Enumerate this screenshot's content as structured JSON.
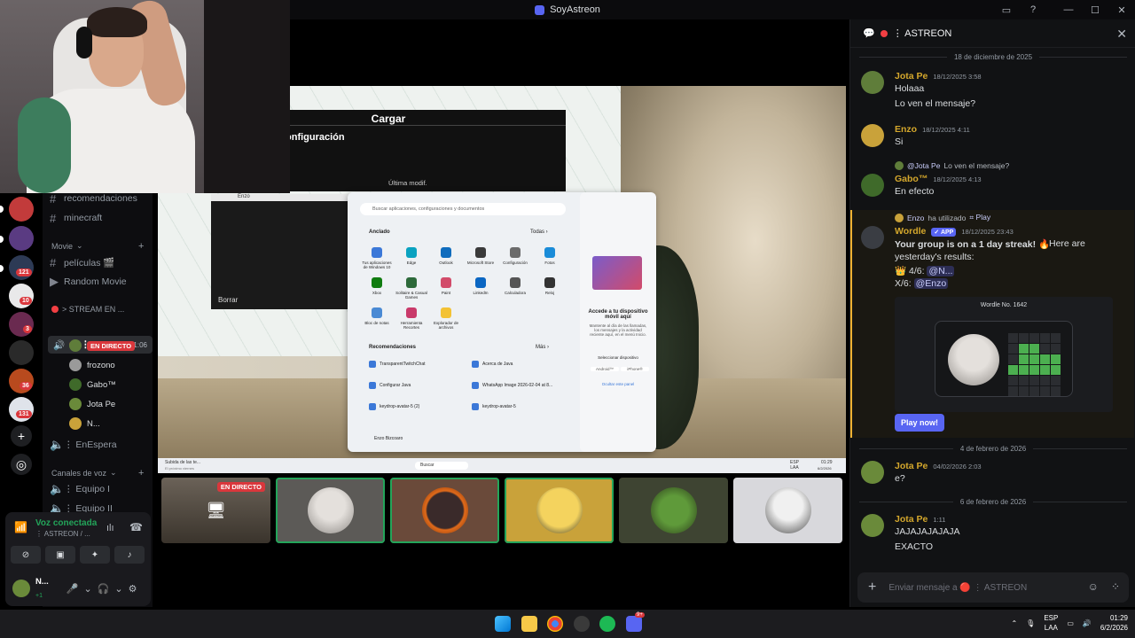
{
  "window": {
    "title": "SoyAstreon"
  },
  "rail_badges": [
    "121",
    "10",
    "3",
    "36",
    "131"
  ],
  "channels": {
    "text": [
      {
        "name": "recomendaciones"
      },
      {
        "name": "minecraft"
      }
    ],
    "movie_category": "Movie",
    "movie_channels": [
      {
        "name": "películas 🎬"
      },
      {
        "name": "Random Movie"
      }
    ],
    "stream_category": "> STREAM EN ...",
    "active_voice": {
      "name": "⋮ AS...",
      "time": "21:06"
    },
    "voice_users": [
      {
        "name": "EN DIRECTO",
        "is_live_badge": true
      },
      {
        "name": "frozono"
      },
      {
        "name": "Gabo™"
      },
      {
        "name": "Jota Pe"
      },
      {
        "name": "N..."
      }
    ],
    "waiting": "⋮ EnEspera",
    "voice_category": "Canales de voz",
    "voice_channels": [
      {
        "name": "⋮ Equipo I"
      },
      {
        "name": "⋮ Equipo II"
      }
    ]
  },
  "voice_panel": {
    "status": "Voz conectada",
    "sub": "⋮ ASTREON / ...",
    "user": "N...",
    "user_sub": "+1"
  },
  "stream": {
    "cargar_title": "Cargar",
    "cargar_item": "onfiguración",
    "cargar_footer": "Última modif.",
    "borrar": "Borrar",
    "enzo_tab": "Enzo",
    "search_placeholder": "Buscar aplicaciones, configuraciones y documentos",
    "pinned_label": "Anclado",
    "all_label": "Todas ›",
    "apps": [
      "Tus aplicaciones de Windows 10",
      "Edge",
      "Outlook",
      "Microsoft Store",
      "Configuración",
      "Fotos",
      "Xbox",
      "Solitaire & Casual Games",
      "Paint",
      "LinkedIn",
      "Calculadora",
      "Reloj",
      "Bloc de notas",
      "Herramienta Recortes",
      "Explorador de archivos"
    ],
    "recs_label": "Recomendaciones",
    "more_label": "Más ›",
    "recs": [
      "TransparentTwitchChat",
      "Acerca de Java",
      "Configurar Java",
      "WhatsApp Image 2026-02-04 at 8...",
      "keydrop-avatar-5 (2)",
      "keydrop-avatar-5"
    ],
    "user_label": "Enzo Bizcoaro",
    "side_title": "Accede a tu dispositivo móvil aquí",
    "side_text": "Mantente al día de las llamadas, los mensajes y la actividad reciente aquí, en el menú Inicio.",
    "side_select": "Seleccionar dispositivo",
    "side_android": "Android™",
    "side_iphone": "iPhone®",
    "side_hide": "Ocultar este panel",
    "taskbar_search": "Buscar",
    "taskbar_lang": "ESP LAA",
    "taskbar_time": "01:29",
    "taskbar_date": "6/2/2026",
    "mini_notif": "Subida de las te...",
    "mini_notif_sub": "El próximo viernes"
  },
  "tiles": [
    {
      "label": "EN DIRECTO",
      "type": "stream"
    },
    {
      "label": "",
      "type": "user"
    },
    {
      "label": "",
      "type": "user"
    },
    {
      "label": "",
      "type": "user"
    },
    {
      "label": "",
      "type": "user"
    },
    {
      "label": "",
      "type": "user"
    }
  ],
  "chat": {
    "header": "⋮ ASTREON",
    "dividers": [
      "18 de diciembre de 2025",
      "4 de febrero de 2026",
      "6 de febrero de 2026"
    ],
    "messages": [
      {
        "author": "Jota Pe",
        "time": "18/12/2025 3:58",
        "lines": [
          "Holaaa",
          "Lo ven el mensaje?"
        ]
      },
      {
        "author": "Enzo",
        "time": "18/12/2025 4:11",
        "lines": [
          "Si"
        ]
      },
      {
        "reply_to": "@Jota Pe",
        "reply_text": "Lo ven el mensaje?",
        "author": "Gabo™",
        "time": "18/12/2025 4:13",
        "lines": [
          "En efecto"
        ]
      },
      {
        "reply_to": "Enzo",
        "reply_text": "ha utilizado",
        "reply_cmd": "⌗ Play",
        "author": "Wordle",
        "app": "✓ APP",
        "time": "18/12/2025 23:43",
        "streak": "Your group is on a 1 day streak! 🔥",
        "results_a": "Here are",
        "results_b": "yesterday's results:",
        "line1_prefix": "👑 4/6:",
        "line1_mention": "@N...",
        "line2_prefix": "X/6:",
        "line2_mention": "@Enzo",
        "embed_title": "Wordle No. 1642",
        "button": "Play now!"
      },
      {
        "author": "Jota Pe",
        "time": "04/02/2026 2:03",
        "lines": [
          "e?"
        ]
      },
      {
        "author": "Jota Pe",
        "time": "1:11",
        "lines": [
          "JAJAJAJAJAJA",
          "EXACTO"
        ]
      }
    ],
    "input_placeholder": "Enviar mensaje a 🔴 ⋮ ASTREON"
  },
  "wordle_grid": [
    [
      0,
      0,
      0,
      0,
      0
    ],
    [
      0,
      1,
      1,
      0,
      0
    ],
    [
      0,
      1,
      1,
      1,
      1
    ],
    [
      1,
      1,
      1,
      1,
      1
    ],
    [
      0,
      0,
      0,
      0,
      0
    ],
    [
      0,
      0,
      0,
      0,
      0
    ]
  ],
  "taskbar": {
    "lang_top": "ESP",
    "lang_bottom": "LAA",
    "time": "01:29",
    "date": "6/2/2026",
    "discord_badge": "9+"
  },
  "colors": {
    "accent": "#5865f2",
    "online": "#23a55a",
    "live": "#da373c",
    "name_gold": "#d4a72c"
  }
}
